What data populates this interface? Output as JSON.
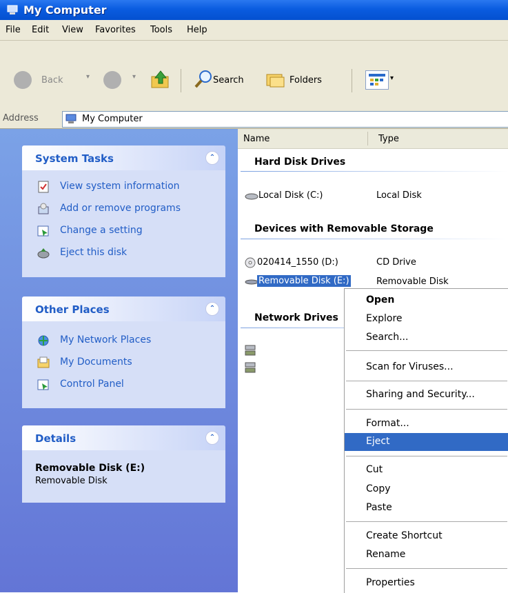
{
  "window": {
    "title": "My Computer"
  },
  "menu": [
    "File",
    "Edit",
    "View",
    "Favorites",
    "Tools",
    "Help"
  ],
  "toolbar": {
    "back": "Back",
    "search": "Search",
    "folders": "Folders"
  },
  "address": {
    "label": "Address",
    "value": "My Computer"
  },
  "system_tasks": {
    "title": "System Tasks",
    "items": [
      "View system information",
      "Add or remove programs",
      "Change a setting",
      "Eject this disk"
    ]
  },
  "other_places": {
    "title": "Other Places",
    "items": [
      "My Network Places",
      "My Documents",
      "Control Panel"
    ]
  },
  "details": {
    "title": "Details",
    "name": "Removable Disk (E:)",
    "type": "Removable Disk"
  },
  "columns": [
    "Name",
    "Type"
  ],
  "groups": {
    "hard_disks": "Hard Disk Drives",
    "removable": "Devices with Removable Storage",
    "network": "Network Drives"
  },
  "drives": [
    {
      "name": "Local Disk (C:)",
      "type": "Local Disk"
    },
    {
      "name": "020414_1550 (D:)",
      "type": "CD Drive"
    },
    {
      "name": "Removable Disk (E:)",
      "type": "Removable Disk"
    }
  ],
  "context_menu": [
    "Open",
    "Explore",
    "Search...",
    "Scan for Viruses...",
    "Sharing and Security...",
    "Format...",
    "Eject",
    "Cut",
    "Copy",
    "Paste",
    "Create Shortcut",
    "Rename",
    "Properties"
  ],
  "colors": {
    "titlebar": "#0a5ce0",
    "task_pane": "#7ba2e7",
    "link": "#215dc6",
    "selection": "#316ac5"
  }
}
